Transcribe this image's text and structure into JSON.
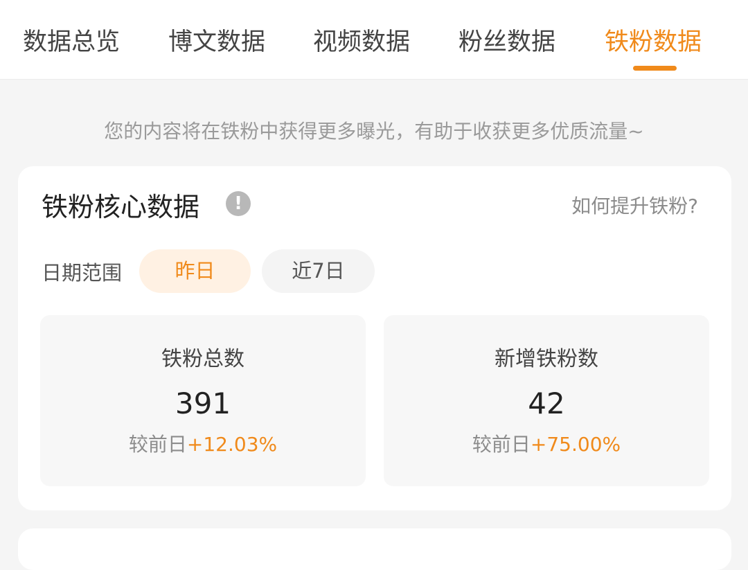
{
  "tabs": [
    {
      "label": "数据总览"
    },
    {
      "label": "博文数据"
    },
    {
      "label": "视频数据"
    },
    {
      "label": "粉丝数据"
    },
    {
      "label": "铁粉数据",
      "active": true
    }
  ],
  "hint": "您的内容将在铁粉中获得更多曝光，有助于收获更多优质流量~",
  "core_card": {
    "title": "铁粉核心数据",
    "info_icon": "!",
    "help_link": "如何提升铁粉?",
    "date_range_label": "日期范围",
    "date_options": [
      {
        "label": "昨日",
        "selected": true
      },
      {
        "label": "近7日",
        "selected": false
      }
    ],
    "stats": [
      {
        "label": "铁粉总数",
        "value": "391",
        "compare_prefix": "较前日",
        "delta": "+12.03%"
      },
      {
        "label": "新增铁粉数",
        "value": "42",
        "compare_prefix": "较前日",
        "delta": "+75.00%"
      }
    ]
  },
  "colors": {
    "accent": "#f08a1b",
    "accent_bg": "#fff1e3"
  }
}
